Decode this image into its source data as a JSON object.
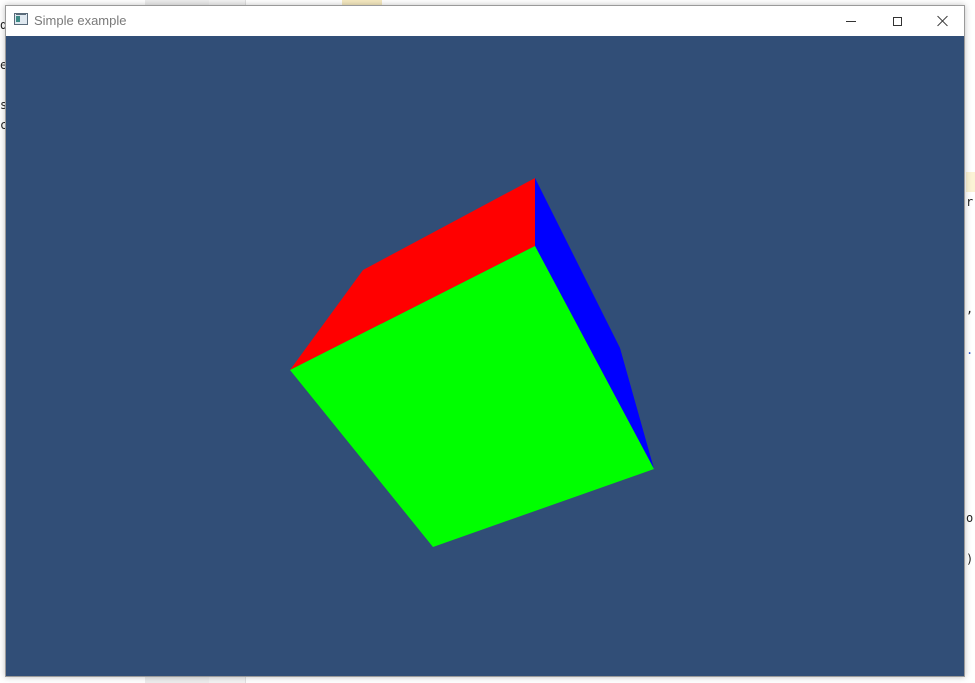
{
  "window": {
    "title": "Simple example",
    "icon": "app-window-icon",
    "controls": {
      "minimize_icon": "minimize-icon",
      "maximize_icon": "maximize-icon",
      "close_icon": "close-icon"
    }
  },
  "scene": {
    "background_color": "#314e77",
    "faces": [
      {
        "name": "top-face",
        "color": "#ff0000"
      },
      {
        "name": "right-face",
        "color": "#0000ff"
      },
      {
        "name": "front-face",
        "color": "#00ff00"
      }
    ]
  },
  "background_glyphs": {
    "left": [
      "d",
      "e",
      "s",
      "c"
    ],
    "right": [
      "r",
      ",",
      ".",
      "o",
      ")"
    ]
  }
}
